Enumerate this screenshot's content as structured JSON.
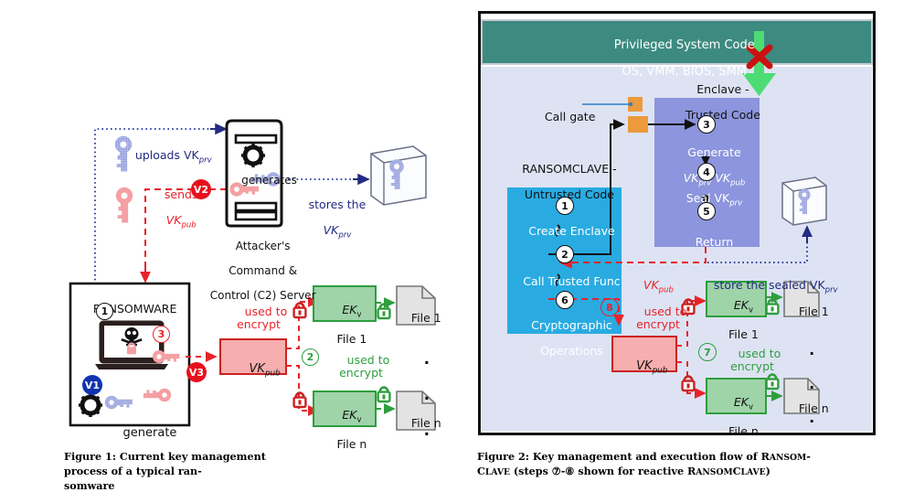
{
  "page": {
    "background": "#ffffff",
    "figure1": {
      "caption_line1": "Figure 1: Current key management process of a typical ran-",
      "caption_line2": "somware",
      "labels": {
        "uploads": "uploads VK",
        "uploads_sub": "prv",
        "sends1": "sends",
        "sends2": "VK",
        "sends2_sub": "pub",
        "generates": "generates",
        "server1": "Attacker's",
        "server2": "Command &",
        "server3": "Control (C2) Server",
        "stores1": "stores the",
        "stores2": "VK",
        "stores2_sub": "prv",
        "ransomware": "RANSOMWARE",
        "generate": "generate",
        "vkpub": "VK",
        "vkpub_sub": "pub",
        "used_to": "used to",
        "encrypt": "encrypt",
        "used_to2": "used to",
        "encrypt2": "encrypt",
        "ek1a": "EK",
        "ek1a_sub": "v",
        "ek1b": "File 1",
        "ekna": "EK",
        "ekna_sub": "v",
        "eknb": "File n",
        "file1": "File 1",
        "filen": "File n",
        "dots": "."
      },
      "markers": {
        "m1": "1",
        "m2": "2",
        "m3": "3",
        "v1": "V1",
        "v2": "V2",
        "v3": "V3"
      }
    },
    "figure2": {
      "caption_line1_a": "Figure 2: Key management and execution flow of R",
      "caption_line1_b": "ANSOM",
      "caption_line1_c": "-",
      "caption_line2_a": "C",
      "caption_line2_b": "LAVE",
      "caption_line2_c": " (steps ⑦-⑧ shown for reactive R",
      "caption_line2_d": "ANSOM",
      "caption_line2_e": "C",
      "caption_line2_f": "LAVE",
      "caption_line2_g": ")",
      "labels": {
        "priv1": "Privileged System Code",
        "priv2": "OS, VMM, BIOS, SMM",
        "enclave1": "Enclave -",
        "enclave2": "Trusted Code",
        "callgate": "Call gate",
        "ransomclave1": "RANSOMCLAVE -",
        "ransomclave2": "Untrusted Code",
        "create_enclave": "Create Enclave",
        "call_trusted": "Call Trusted Func",
        "crypto1": "Cryptographic",
        "crypto2": "Operations",
        "generate1": "Generate",
        "generate2a": "VK",
        "generate2a_sub": "prv",
        "generate2b": "VK",
        "generate2b_sub": "pub",
        "seal": "Seal VK",
        "seal_sub": "prv",
        "return": "Return",
        "vkpub_arrow": "VK",
        "vkpub_arrow_sub": "pub",
        "store_sealed": "store the sealed VK",
        "store_sealed_sub": "prv",
        "vkpub_box": "VK",
        "vkpub_box_sub": "pub",
        "used_to": "used to",
        "encrypt": "encrypt",
        "used_to2": "used to",
        "encrypt2": "encrypt",
        "ek1a": "EK",
        "ek1a_sub": "v",
        "ek1b": "File 1",
        "ekna": "EK",
        "ekna_sub": "v",
        "eknb": "File n",
        "file1": "File 1",
        "filen": "File n",
        "dots": "."
      },
      "markers": {
        "m1": "1",
        "m2": "2",
        "m3": "3",
        "m4": "4",
        "m5": "5",
        "m6": "6",
        "m7": "7",
        "m8": "8"
      }
    },
    "colors": {
      "teal": "#3d8b80",
      "enclave_blue": "#8c95dd",
      "cyan": "#29abe2",
      "lavender_bg": "#dde3f3",
      "red": "#e8232a",
      "dark_red": "#cc2222",
      "green": "#2e9e3e",
      "green_box": "#9fd3a8",
      "navy": "#232c80",
      "orange": "#eb9a3c",
      "pink_box": "#f6aeae",
      "key_blue": "#9fa7e0",
      "key_pink": "#f4a0a4",
      "gray_file": "#e3e3e3"
    }
  }
}
